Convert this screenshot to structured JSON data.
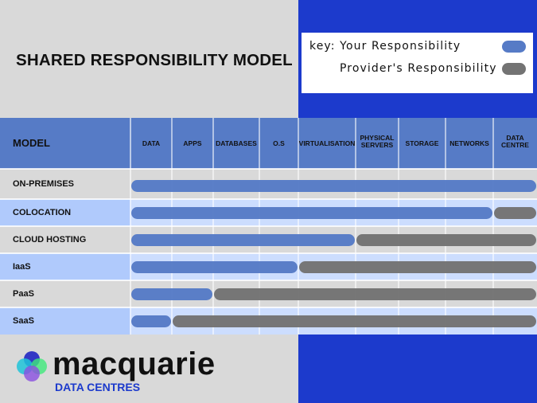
{
  "title": "SHARED RESPONSIBILITY MODEL",
  "key": {
    "prefix": "key:",
    "items": [
      {
        "label": "key: Your Responsibility",
        "color": "#567bc6"
      },
      {
        "label": "Provider's Responsibility",
        "color": "#737373"
      }
    ]
  },
  "colors": {
    "yours": "#567bc6",
    "provider": "#737373",
    "header": "#567bc6",
    "accent_blue": "#1c3acc",
    "row_even_label": "#d9d9d9",
    "row_even_grid": "#d9d9d9",
    "row_odd_label": "#b0cafc",
    "row_odd_grid": "#ccddfe"
  },
  "table": {
    "model_header": "MODEL",
    "columns": [
      "DATA",
      "APPS",
      "DATABASES",
      "O.S",
      "VIRTUALISATION",
      "PHYSICAL SERVERS",
      "STORAGE",
      "NETWORKS",
      "DATA CENTRE"
    ],
    "rows": [
      {
        "label": "ON-PREMISES",
        "your_layers": 9,
        "provider_layers": 0
      },
      {
        "label": "COLOCATION",
        "your_layers": 8,
        "provider_layers": 1
      },
      {
        "label": "CLOUD HOSTING",
        "your_layers": 5,
        "provider_layers": 4
      },
      {
        "label": "IaaS",
        "your_layers": 4,
        "provider_layers": 5
      },
      {
        "label": "PaaS",
        "your_layers": 2,
        "provider_layers": 7
      },
      {
        "label": "SaaS",
        "your_layers": 1,
        "provider_layers": 8
      }
    ]
  },
  "logo": {
    "wordmark": "macquarie",
    "subtitle": "DATA CENTRES"
  }
}
